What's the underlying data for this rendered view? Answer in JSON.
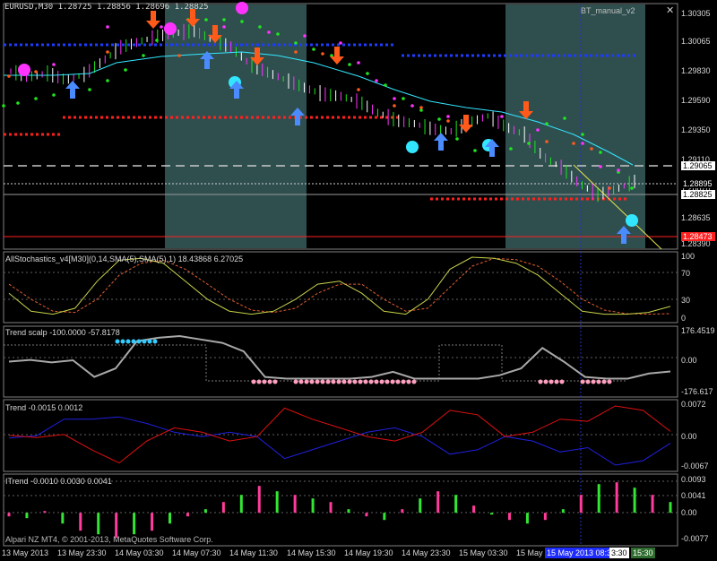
{
  "colors": {
    "bg": "#000000",
    "session_shade": "#2f4f4f",
    "grid_dots": "#5f5f5f",
    "buy_arrow": "#4a8cff",
    "sell_arrow": "#ff5a1a",
    "magenta": "#ff33ff",
    "cyan": "#33e6ff",
    "green_dots": "#1ee61e",
    "blue_level": "#1e3cff",
    "red_level": "#ff2020",
    "white_dash": "#c8c8c8",
    "yellow": "#e6e650",
    "pink": "#ff3c9c",
    "trend_red": "#e01010",
    "trend_blue": "#2020e0",
    "scalp_line": "#a8a8a8",
    "sky_dots": "#33ccff",
    "pink_dots": "#ff9fc0",
    "hist_green": "#33e633",
    "hist_pink": "#ff3c9c",
    "stoch_main": "#c8d24a",
    "stoch_signal": "#e06030"
  },
  "header": {
    "symbol_line": "EURUSD,M30  1.28725 1.28856 1.28696 1.28825",
    "indicator_name": "BT_manual_v2",
    "close_label": "✕",
    "close_icon": "close-icon"
  },
  "price_axis": {
    "ticks": [
      "1.30305",
      "1.30065",
      "1.29830",
      "1.29590",
      "1.29350",
      "1.29110",
      "1.28870",
      "1.28635",
      "1.28390"
    ],
    "current_price": "1.28825",
    "marker_1": "1.29065",
    "marker_2": "1.28895",
    "marker_red": "1.28473"
  },
  "panels": {
    "stochastics": {
      "label": "AllStochastics_v4[M30](0,14,SMA(5),SMA(5),1) 18.43868 6.27025",
      "ticks": [
        "100",
        "70",
        "30",
        "0"
      ]
    },
    "trend_scalp": {
      "label": "Trend scalp -100.0000 -57.8178",
      "ticks": [
        "176.4519",
        "0.00",
        "-176.617"
      ]
    },
    "trend": {
      "label": "Trend -0.0015 0.0012",
      "ticks": [
        "0.0072",
        "0.00",
        "-0.0067"
      ]
    },
    "itrend": {
      "label": "ITrend -0.0010 0.0030 0.0041",
      "ticks": [
        "0.0093",
        "0.0041",
        "0.00",
        "-0.0077"
      ]
    }
  },
  "footer": {
    "copyright": "Alpari NZ MT4, © 2001-2013, MetaQuotes Software Corp."
  },
  "time_axis": {
    "labels": [
      "13 May 2013",
      "13 May 23:30",
      "14 May 03:30",
      "14 May 07:30",
      "14 May 11:30",
      "14 May 15:30",
      "14 May 19:30",
      "14 May 23:30",
      "15 May 03:30",
      "15 May"
    ],
    "highlight_label": "15 May 2013 08:30",
    "last_label_1": "3:30",
    "last_label_2": "15:30"
  },
  "chart_data": [
    {
      "type": "line",
      "title": "EURUSD,M30",
      "ylim": [
        1.2825,
        1.304
      ],
      "series": [
        {
          "name": "price",
          "values": [
            1.2983,
            1.2978,
            1.2981,
            1.2975,
            1.298,
            1.2992,
            1.3005,
            1.301,
            1.3015,
            1.3018,
            1.302,
            1.3012,
            1.3005,
            1.299,
            1.2982,
            1.2975,
            1.2968,
            1.2962,
            1.296,
            1.2955,
            1.2945,
            1.2938,
            1.2935,
            1.293,
            1.2928,
            1.2936,
            1.2942,
            1.2932,
            1.2925,
            1.2905,
            1.2895,
            1.288,
            1.287,
            1.2875,
            1.2882
          ]
        },
        {
          "name": "cyan_ma",
          "values": [
            1.2978,
            1.2978,
            1.2979,
            1.2979,
            1.2982,
            1.2986,
            1.299,
            1.2992,
            1.2993,
            1.2994,
            1.2993,
            1.299,
            1.2986,
            1.2982,
            1.2978,
            1.2972,
            1.2966,
            1.296,
            1.2955,
            1.295,
            1.2946,
            1.2942,
            1.294,
            1.2938,
            1.2937,
            1.2936,
            1.2935,
            1.2933,
            1.2928,
            1.2921,
            1.2914,
            1.2909,
            1.2906,
            1.2906,
            1.2906
          ]
        }
      ]
    },
    {
      "type": "line",
      "title": "AllStochastics_v4",
      "ylim": [
        0,
        100
      ],
      "series": [
        {
          "name": "main",
          "values": [
            40,
            10,
            5,
            15,
            60,
            95,
            98,
            90,
            60,
            30,
            10,
            5,
            10,
            30,
            55,
            60,
            40,
            10,
            5,
            30,
            80,
            100,
            98,
            90,
            70,
            40,
            10,
            5,
            5,
            8,
            18
          ]
        },
        {
          "name": "signal",
          "values": [
            55,
            30,
            10,
            8,
            30,
            70,
            90,
            95,
            80,
            55,
            30,
            12,
            8,
            15,
            40,
            55,
            55,
            30,
            10,
            15,
            50,
            85,
            98,
            96,
            85,
            60,
            30,
            12,
            6,
            5,
            6
          ]
        }
      ]
    },
    {
      "type": "line",
      "title": "Trend scalp",
      "ylim": [
        -176.617,
        176.4519
      ],
      "series": [
        {
          "name": "scalp",
          "values": [
            0,
            10,
            -5,
            8,
            -90,
            -40,
            120,
            140,
            150,
            130,
            110,
            60,
            -90,
            -100,
            -100,
            -100,
            -100,
            -90,
            -60,
            -100,
            -100,
            -100,
            -100,
            -80,
            -40,
            80,
            0,
            -90,
            -100,
            -100,
            -70,
            -58
          ]
        }
      ]
    },
    {
      "type": "line",
      "title": "Trend",
      "ylim": [
        -0.0067,
        0.0072
      ],
      "series": [
        {
          "name": "red",
          "values": [
            0.0003,
            -0.0002,
            0.0005,
            -0.003,
            -0.006,
            -0.001,
            0.002,
            0.001,
            -0.001,
            0.0,
            0.0065,
            0.004,
            0.002,
            0.0,
            -0.001,
            0.001,
            0.006,
            0.005,
            0.0,
            0.001,
            0.004,
            0.0035,
            0.007,
            0.006,
            0.0012
          ]
        },
        {
          "name": "blue",
          "values": [
            -0.0003,
            0.0002,
            0.004,
            0.004,
            0.0045,
            0.003,
            0.001,
            0.0,
            0.001,
            0.0,
            -0.005,
            -0.003,
            -0.001,
            0.001,
            0.002,
            0.0,
            -0.004,
            -0.003,
            0.0,
            -0.001,
            -0.0035,
            -0.0025,
            -0.0065,
            -0.0055,
            -0.0015
          ]
        }
      ]
    },
    {
      "type": "bar",
      "title": "ITrend",
      "ylim": [
        -0.0077,
        0.0093
      ],
      "series": [
        {
          "name": "histogram",
          "values": [
            -0.001,
            -0.0015,
            0.0005,
            -0.003,
            -0.005,
            -0.006,
            -0.007,
            -0.006,
            -0.005,
            -0.003,
            -0.001,
            0.001,
            0.003,
            0.005,
            0.0075,
            0.006,
            0.005,
            0.004,
            0.003,
            0.001,
            -0.001,
            -0.002,
            0.001,
            0.004,
            0.006,
            0.005,
            0.002,
            -0.0005,
            -0.002,
            -0.003,
            -0.002,
            0.001,
            0.005,
            0.008,
            0.0085,
            0.007,
            0.005,
            0.003
          ]
        }
      ]
    }
  ]
}
